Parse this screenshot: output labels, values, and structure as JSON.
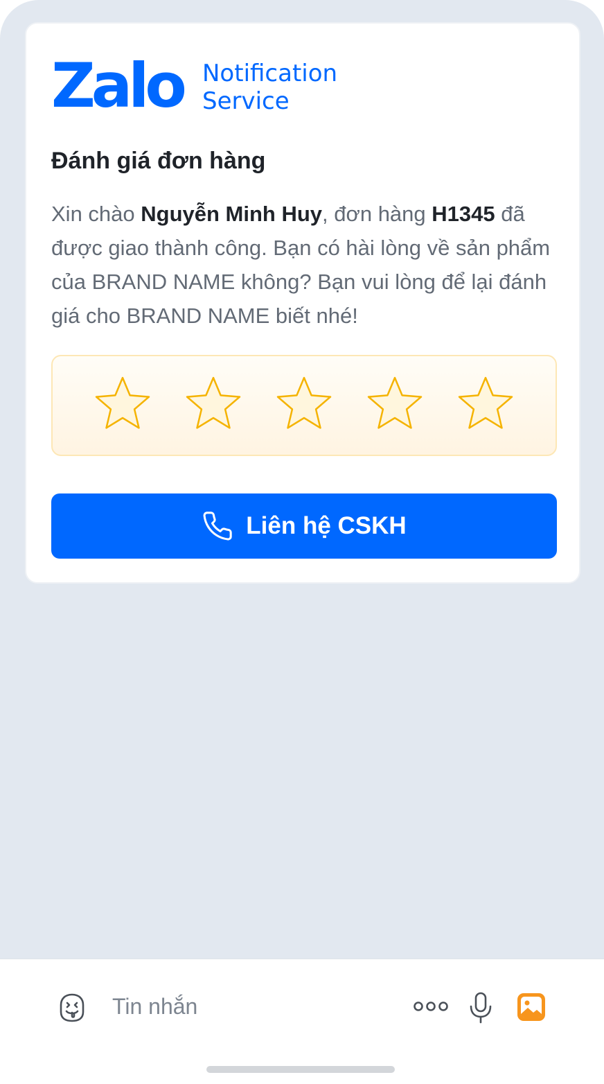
{
  "brand": {
    "wordmark": "Zalo",
    "service_line1": "Notification",
    "service_line2": "Service",
    "color": "#0068ff"
  },
  "notification": {
    "title": "Đánh giá đơn hàng",
    "greeting": "Xin chào ",
    "customer_name": "Nguyễn Minh Huy",
    "order_prefix": ", đơn hàng ",
    "order_id": "H1345",
    "message_rest": " đã được giao thành công. Bạn có hài lòng về sản phẩm của BRAND NAME không? Bạn vui lòng để lại đánh giá cho BRAND NAME biết nhé!"
  },
  "rating": {
    "max": 5,
    "selected": 0,
    "star_icon": "star-outline-icon",
    "star_stroke_color": "#f5b300",
    "star_fill_color": "#fff6dd"
  },
  "cta": {
    "label": "Liên hệ CSKH",
    "icon": "phone-icon",
    "color": "#0068ff"
  },
  "composer": {
    "placeholder": "Tin nhắn",
    "icons": [
      "emoji-icon",
      "more-dots-icon",
      "microphone-icon",
      "photo-icon"
    ]
  }
}
